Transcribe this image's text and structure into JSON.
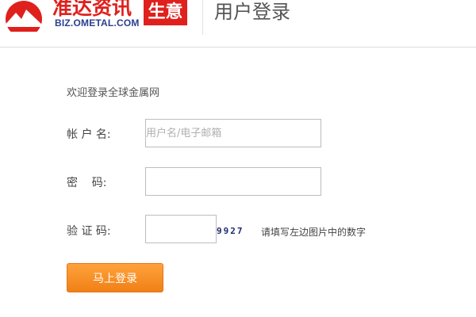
{
  "brand": {
    "logo_text": "准达资讯",
    "logo_domain": "BIZ.OMETAL.COM",
    "badge_text": "生意",
    "colors": {
      "brand_red": "#e0201c",
      "domain_blue": "#2b3f8f"
    }
  },
  "page": {
    "title": "用户登录"
  },
  "form": {
    "welcome": "欢迎登录全球金属网",
    "account_label": "帐 户 名:",
    "account_placeholder": "用户名/电子邮箱",
    "password_label": "密    码:",
    "captcha_label": "验 证 码:",
    "captcha_code": "9927",
    "captcha_hint": "请填写左边图片中的数字",
    "submit_label": "马上登录",
    "button_color": "#f08016"
  }
}
